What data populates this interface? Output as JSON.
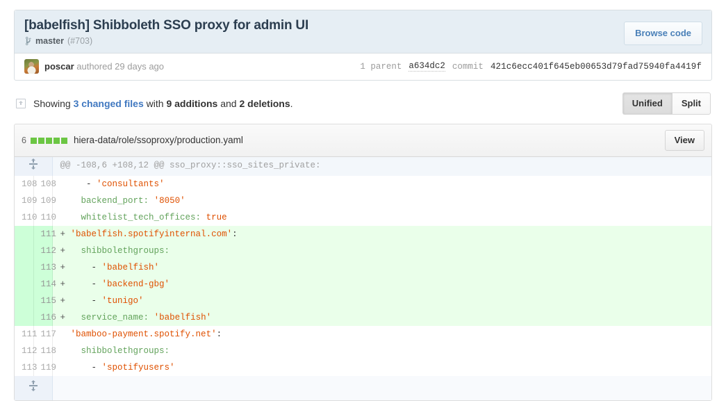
{
  "commit": {
    "title": "[babelfish] Shibboleth SSO proxy for admin UI",
    "branch_icon": "git-branch-icon",
    "branch": "master",
    "pull_request": "(#703)",
    "browse_code_label": "Browse code",
    "author": "poscar",
    "authored_text": " authored 29 days ago",
    "parent_label": "1 parent",
    "parent_sha": "a634dc2",
    "commit_label": "commit",
    "commit_sha": "421c6ecc401f645eb00653d79fad75940fa4419f"
  },
  "toolbar": {
    "diffstat_icon": "diff-file-icon",
    "showing_prefix": "Showing ",
    "changed_files": "3 changed files",
    "with_text": " with ",
    "additions": "9 additions",
    "and_text": " and ",
    "deletions": "2 deletions",
    "period": ".",
    "unified_label": "Unified",
    "split_label": "Split",
    "active_view": "Unified"
  },
  "file": {
    "change_count": "6",
    "diffstat_blocks": [
      "add",
      "add",
      "add",
      "add",
      "add"
    ],
    "path": "hiera-data/role/ssoproxy/production.yaml",
    "view_label": "View"
  },
  "diff": {
    "expand_icon": "unfold-icon",
    "hunk_header": "@@ -108,6 +108,12 @@ sso_proxy::sso_sites_private:",
    "rows": [
      {
        "type": "ctx",
        "old": "108",
        "new": "108",
        "marker": " ",
        "tokens": [
          {
            "t": "    - ",
            "c": "s-plain"
          },
          {
            "t": "'consultants'",
            "c": "s-str"
          }
        ]
      },
      {
        "type": "ctx",
        "old": "109",
        "new": "109",
        "marker": " ",
        "tokens": [
          {
            "t": "   backend_port:",
            "c": "s-key"
          },
          {
            "t": " ",
            "c": "s-plain"
          },
          {
            "t": "'8050'",
            "c": "s-str"
          }
        ]
      },
      {
        "type": "ctx",
        "old": "110",
        "new": "110",
        "marker": " ",
        "tokens": [
          {
            "t": "   whitelist_tech_offices:",
            "c": "s-key"
          },
          {
            "t": " ",
            "c": "s-plain"
          },
          {
            "t": "true",
            "c": "s-const"
          }
        ]
      },
      {
        "type": "add",
        "old": "",
        "new": "111",
        "marker": "+",
        "tokens": [
          {
            "t": " ",
            "c": "s-plain"
          },
          {
            "t": "'babelfish.spotifyinternal.com'",
            "c": "s-str"
          },
          {
            "t": ":",
            "c": "s-plain"
          }
        ]
      },
      {
        "type": "add",
        "old": "",
        "new": "112",
        "marker": "+",
        "tokens": [
          {
            "t": "   shibbolethgroups:",
            "c": "s-key"
          }
        ]
      },
      {
        "type": "add",
        "old": "",
        "new": "113",
        "marker": "+",
        "tokens": [
          {
            "t": "     - ",
            "c": "s-plain"
          },
          {
            "t": "'babelfish'",
            "c": "s-str"
          }
        ]
      },
      {
        "type": "add",
        "old": "",
        "new": "114",
        "marker": "+",
        "tokens": [
          {
            "t": "     - ",
            "c": "s-plain"
          },
          {
            "t": "'backend-gbg'",
            "c": "s-str"
          }
        ]
      },
      {
        "type": "add",
        "old": "",
        "new": "115",
        "marker": "+",
        "tokens": [
          {
            "t": "     - ",
            "c": "s-plain"
          },
          {
            "t": "'tunigo'",
            "c": "s-str"
          }
        ]
      },
      {
        "type": "add",
        "old": "",
        "new": "116",
        "marker": "+",
        "tokens": [
          {
            "t": "   service_name:",
            "c": "s-key"
          },
          {
            "t": " ",
            "c": "s-plain"
          },
          {
            "t": "'babelfish'",
            "c": "s-str"
          }
        ]
      },
      {
        "type": "ctx",
        "old": "111",
        "new": "117",
        "marker": " ",
        "tokens": [
          {
            "t": " ",
            "c": "s-plain"
          },
          {
            "t": "'bamboo-payment.spotify.net'",
            "c": "s-str"
          },
          {
            "t": ":",
            "c": "s-plain"
          }
        ]
      },
      {
        "type": "ctx",
        "old": "112",
        "new": "118",
        "marker": " ",
        "tokens": [
          {
            "t": "   shibbolethgroups:",
            "c": "s-key"
          }
        ]
      },
      {
        "type": "ctx",
        "old": "113",
        "new": "119",
        "marker": " ",
        "tokens": [
          {
            "t": "     - ",
            "c": "s-plain"
          },
          {
            "t": "'spotifyusers'",
            "c": "s-str"
          }
        ]
      }
    ]
  },
  "colors": {
    "accent_link": "#4078c0",
    "addition_bg": "#eaffea",
    "addition_gutter": "#cdffd8",
    "diffstat_add": "#6cc644",
    "header_bg": "#e6eef4",
    "yaml_key": "#63a35c",
    "yaml_string": "#df5000"
  }
}
